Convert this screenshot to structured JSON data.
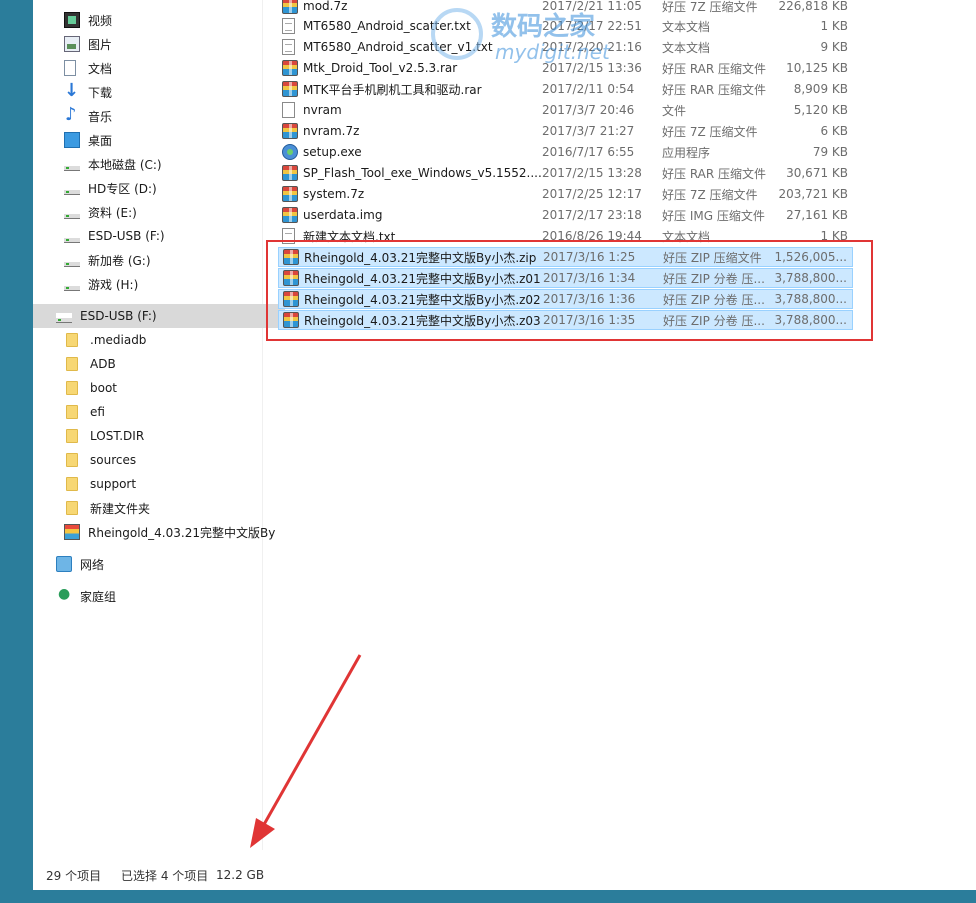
{
  "sidebar": {
    "quick_access": [
      {
        "label": "视频",
        "icon": "video-icon"
      },
      {
        "label": "图片",
        "icon": "pictures-icon"
      },
      {
        "label": "文档",
        "icon": "documents-icon"
      },
      {
        "label": "下载",
        "icon": "download-icon"
      },
      {
        "label": "音乐",
        "icon": "music-icon"
      },
      {
        "label": "桌面",
        "icon": "desktop-icon"
      },
      {
        "label": "本地磁盘 (C:)",
        "icon": "drive-icon"
      },
      {
        "label": "HD专区 (D:)",
        "icon": "drive-icon"
      },
      {
        "label": "资料 (E:)",
        "icon": "drive-icon"
      },
      {
        "label": "ESD-USB (F:)",
        "icon": "usb-drive-icon"
      },
      {
        "label": "新加卷 (G:)",
        "icon": "drive-icon"
      },
      {
        "label": "游戏 (H:)",
        "icon": "drive-icon"
      }
    ],
    "esd_drive": {
      "label": "ESD-USB (F:)",
      "icon": "usb-drive-icon"
    },
    "esd_folders": [
      {
        "label": ".mediadb"
      },
      {
        "label": "ADB"
      },
      {
        "label": "boot"
      },
      {
        "label": "efi"
      },
      {
        "label": "LOST.DIR"
      },
      {
        "label": "sources"
      },
      {
        "label": "support"
      },
      {
        "label": "新建文件夹"
      },
      {
        "label": "Rheingold_4.03.21完整中文版By"
      }
    ],
    "network": {
      "label": "网络"
    },
    "homegroup": {
      "label": "家庭组"
    }
  },
  "files": [
    {
      "name": "mod.7z",
      "date": "2017/2/21 11:05",
      "type": "好压 7Z 压缩文件",
      "size": "226,818 KB",
      "icon": "archive-icon",
      "selected": false
    },
    {
      "name": "MT6580_Android_scatter.txt",
      "date": "2017/2/17 22:51",
      "type": "文本文档",
      "size": "1 KB",
      "icon": "text-file-icon",
      "selected": false
    },
    {
      "name": "MT6580_Android_scatter_v1.txt",
      "date": "2017/2/20 21:16",
      "type": "文本文档",
      "size": "9 KB",
      "icon": "text-file-icon",
      "selected": false
    },
    {
      "name": "Mtk_Droid_Tool_v2.5.3.rar",
      "date": "2017/2/15 13:36",
      "type": "好压 RAR 压缩文件",
      "size": "10,125 KB",
      "icon": "archive-icon",
      "selected": false
    },
    {
      "name": "MTK平台手机刷机工具和驱动.rar",
      "date": "2017/2/11 0:54",
      "type": "好压 RAR 压缩文件",
      "size": "8,909 KB",
      "icon": "archive-icon",
      "selected": false
    },
    {
      "name": "nvram",
      "date": "2017/3/7 20:46",
      "type": "文件",
      "size": "5,120 KB",
      "icon": "blank-file-icon",
      "selected": false
    },
    {
      "name": "nvram.7z",
      "date": "2017/3/7 21:27",
      "type": "好压 7Z 压缩文件",
      "size": "6 KB",
      "icon": "archive-icon",
      "selected": false
    },
    {
      "name": "setup.exe",
      "date": "2016/7/17 6:55",
      "type": "应用程序",
      "size": "79 KB",
      "icon": "setup-icon",
      "selected": false
    },
    {
      "name": "SP_Flash_Tool_exe_Windows_v5.1552....",
      "date": "2017/2/15 13:28",
      "type": "好压 RAR 压缩文件",
      "size": "30,671 KB",
      "icon": "archive-icon",
      "selected": false
    },
    {
      "name": "system.7z",
      "date": "2017/2/25 12:17",
      "type": "好压 7Z 压缩文件",
      "size": "203,721 KB",
      "icon": "archive-icon",
      "selected": false
    },
    {
      "name": "userdata.img",
      "date": "2017/2/17 23:18",
      "type": "好压 IMG 压缩文件",
      "size": "27,161 KB",
      "icon": "archive-icon",
      "selected": false
    },
    {
      "name": "新建文本文档.txt",
      "date": "2016/8/26 19:44",
      "type": "文本文档",
      "size": "1 KB",
      "icon": "text-file-icon",
      "selected": false
    },
    {
      "name": "Rheingold_4.03.21完整中文版By小杰.zip",
      "date": "2017/3/16 1:25",
      "type": "好压 ZIP 压缩文件",
      "size": "1,526,005...",
      "icon": "archive-icon",
      "selected": true
    },
    {
      "name": "Rheingold_4.03.21完整中文版By小杰.z01",
      "date": "2017/3/16 1:34",
      "type": "好压 ZIP 分卷 压...",
      "size": "3,788,800...",
      "icon": "archive-icon",
      "selected": true
    },
    {
      "name": "Rheingold_4.03.21完整中文版By小杰.z02",
      "date": "2017/3/16 1:36",
      "type": "好压 ZIP 分卷 压...",
      "size": "3,788,800...",
      "icon": "archive-icon",
      "selected": true
    },
    {
      "name": "Rheingold_4.03.21完整中文版By小杰.z03",
      "date": "2017/3/16 1:35",
      "type": "好压 ZIP 分卷 压...",
      "size": "3,788,800...",
      "icon": "archive-icon",
      "selected": true
    }
  ],
  "watermark": {
    "cn": "数码之家",
    "url": "mydigit.net"
  },
  "status": {
    "count": "29 个项目",
    "selected": "已选择 4 个项目",
    "size": "12.2 GB"
  },
  "colors": {
    "highlight_box": "#e03535",
    "selection": "#cce8ff",
    "annotation_arrow": "#e03535"
  }
}
